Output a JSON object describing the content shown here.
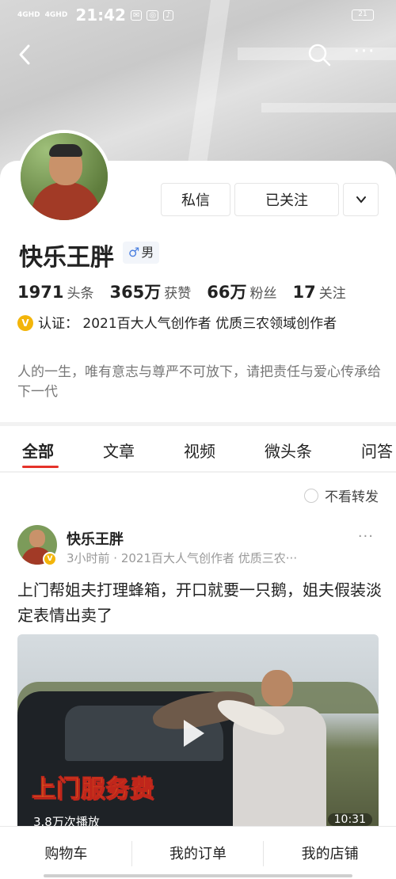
{
  "status_bar": {
    "signal1": "4GHD",
    "signal2": "4GHD",
    "time": "21:42",
    "battery": "21"
  },
  "navbar": {
    "more": "···"
  },
  "profile": {
    "name": "快乐王胖",
    "gender_symbol": "♂",
    "gender": "男",
    "buttons": {
      "message": "私信",
      "following": "已关注"
    },
    "stats": [
      {
        "num": "1971",
        "label": "头条"
      },
      {
        "num": "365万",
        "label": "获赞"
      },
      {
        "num": "66万",
        "label": "粉丝"
      },
      {
        "num": "17",
        "label": "关注"
      }
    ],
    "verify_badge": "V",
    "verification": "认证： 2021百大人气创作者 优质三农领域创作者",
    "bio": "人的一生，唯有意志与尊严不可放下，请把责任与爱心传承给下一代"
  },
  "tabs": [
    "全部",
    "文章",
    "视频",
    "微头条",
    "问答"
  ],
  "filter": {
    "label": "不看转发"
  },
  "post": {
    "author": "快乐王胖",
    "badge": "V",
    "meta": "3小时前 · 2021百大人气创作者 优质三农···",
    "more": "···",
    "title": "上门帮姐夫打理蜂箱，开口就要一只鹅，姐夫假装淡定表情出卖了",
    "video_caption": "上门服务费",
    "views": "3.8万次播放",
    "duration": "10:31"
  },
  "bottom_bar": [
    "购物车",
    "我的订单",
    "我的店铺"
  ]
}
